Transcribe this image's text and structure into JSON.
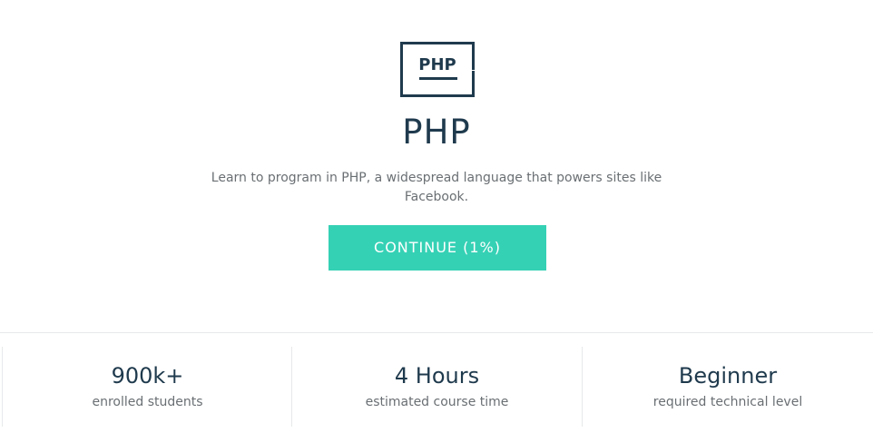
{
  "course": {
    "logo_text": "PHP",
    "title": "PHP",
    "description": "Learn to program in PHP, a widespread language that powers sites like Facebook.",
    "continue_label": "CONTINUE (1%)"
  },
  "stats": [
    {
      "value": "900k+",
      "label": "enrolled students"
    },
    {
      "value": "4 Hours",
      "label": "estimated course time"
    },
    {
      "value": "Beginner",
      "label": "required technical level"
    }
  ],
  "colors": {
    "accent": "#35d1b5",
    "heading": "#1f3a4d",
    "body_text": "#6a6f73",
    "divider": "#e6e8ea"
  }
}
